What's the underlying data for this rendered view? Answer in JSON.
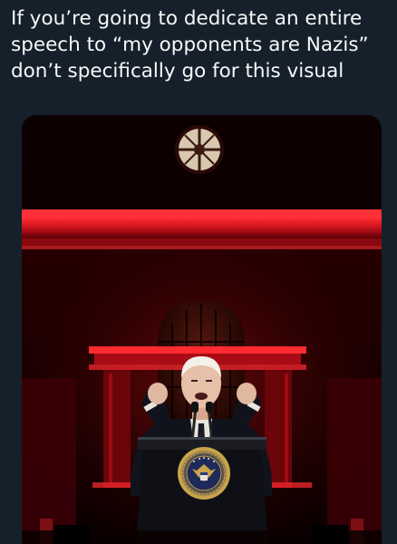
{
  "tweet": {
    "text": "If you’re going to dedicate an entire\nspeech to “my opponents are Nazis”\ndon’t specifically go for this visual"
  },
  "media": {
    "type": "photo",
    "seal_text": "PRESIDENT OF THE UNITED STATES",
    "colors": {
      "background": "#15202b",
      "text": "#f7f9f9",
      "red_glow": "#d8141c",
      "sky": "#070000"
    }
  }
}
